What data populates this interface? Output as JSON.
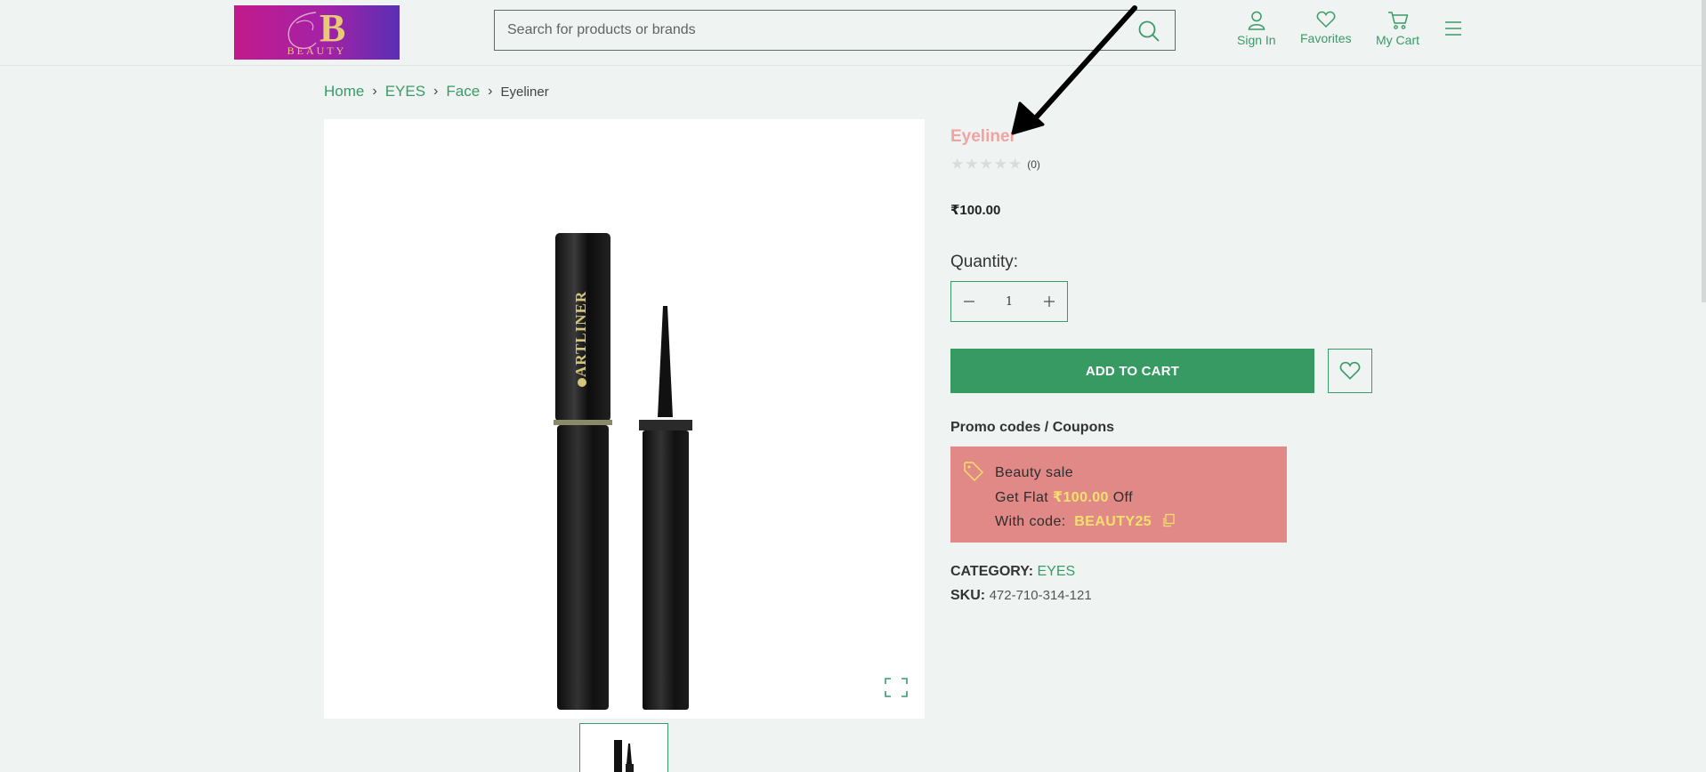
{
  "header": {
    "logo_text": "BEAUTY",
    "search": {
      "placeholder": "Search for products or brands"
    },
    "nav": {
      "sign_in": "Sign In",
      "favorites": "Favorites",
      "my_cart": "My Cart"
    }
  },
  "breadcrumb": {
    "items": [
      "Home",
      "EYES",
      "Face"
    ],
    "current": "Eyeliner"
  },
  "product": {
    "image_label": "ARTLINER",
    "title": "Eyeliner",
    "rating": 0,
    "rating_count": "(0)",
    "price": "₹100.00",
    "quantity_label": "Quantity:",
    "quantity_value": "1",
    "add_to_cart": "ADD TO CART",
    "promo_heading": "Promo codes / Coupons",
    "promo": {
      "name": "Beauty sale",
      "flat_prefix": "Get Flat",
      "flat_amount": "₹100.00",
      "flat_suffix": "Off",
      "code_prefix": "With code:",
      "code": "BEAUTY25"
    },
    "category_label": "CATEGORY:",
    "category_value": "EYES",
    "sku_label": "SKU:",
    "sku_value": "472-710-314-121"
  },
  "colors": {
    "accent": "#389a63",
    "title_pink": "#f0a3a3",
    "promo_bg": "#e18987",
    "promo_highlight": "#f4e06d",
    "page_bg": "#eff3f1"
  },
  "icons": [
    "search-icon",
    "user-icon",
    "heart-icon",
    "cart-icon",
    "menu-icon",
    "chevron-right-icon",
    "expand-icon",
    "minus-icon",
    "plus-icon",
    "tag-icon",
    "copy-icon"
  ]
}
